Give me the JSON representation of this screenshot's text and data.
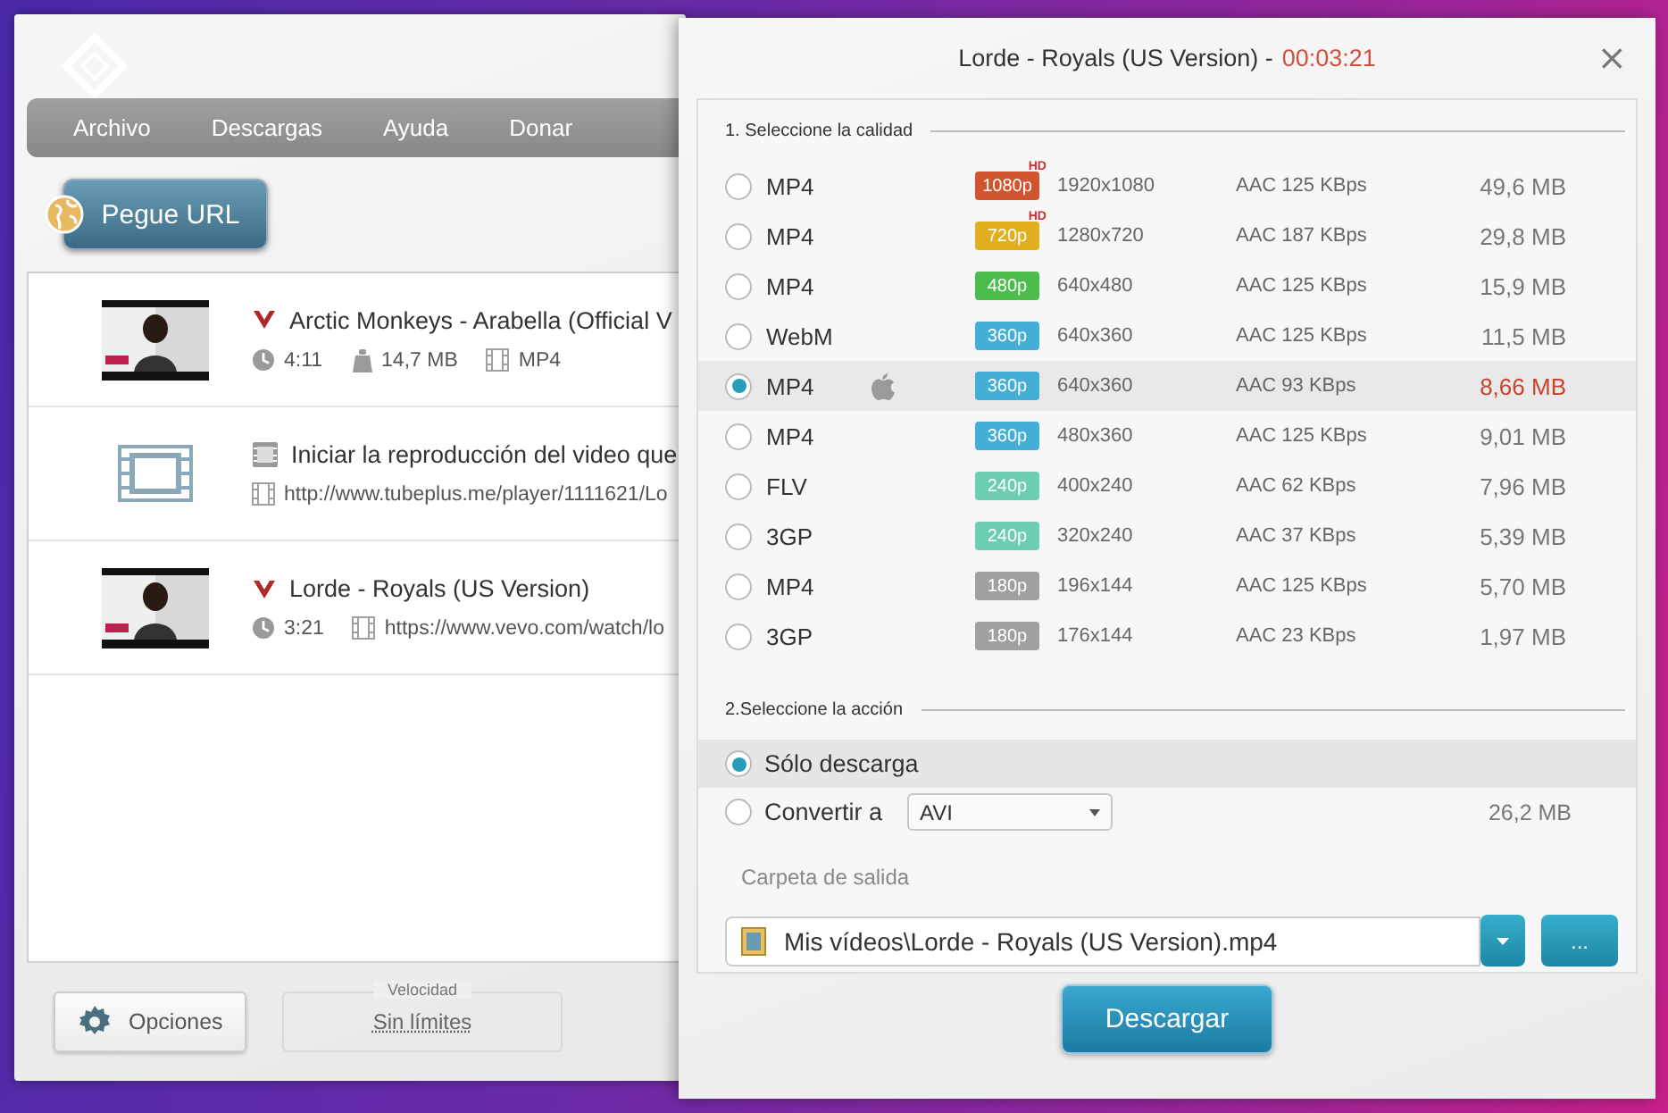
{
  "main_window": {
    "menu": [
      "Archivo",
      "Descargas",
      "Ayuda",
      "Donar"
    ],
    "paste_button": "Pegue URL",
    "downloads": [
      {
        "kind": "video",
        "title": "Arctic Monkeys - Arabella (Official V",
        "meta": [
          {
            "kind": "duration",
            "text": "4:11"
          },
          {
            "kind": "size",
            "text": "14,7 MB"
          },
          {
            "kind": "format",
            "text": "MP4"
          }
        ]
      },
      {
        "kind": "link",
        "title": "Iniciar la reproducción del video que",
        "meta": [
          {
            "kind": "url",
            "text": "http://www.tubeplus.me/player/1111621/Lo"
          }
        ]
      },
      {
        "kind": "video",
        "title": "Lorde - Royals (US Version)",
        "meta": [
          {
            "kind": "duration",
            "text": "3:21"
          },
          {
            "kind": "url",
            "text": "https://www.vevo.com/watch/lo"
          }
        ]
      }
    ],
    "options_button": "Opciones",
    "speed": {
      "label": "Velocidad",
      "value": "Sin límites"
    }
  },
  "dialog": {
    "title": "Lorde - Royals (US Version) -",
    "duration": "00:03:21",
    "close": "×",
    "quality_heading": "1. Seleccione la calidad",
    "qualities": [
      {
        "format": "MP4",
        "preset_icon": false,
        "badge": "1080p",
        "hd_label": "HD",
        "color": "#d0552e",
        "resolution": "1920x1080",
        "audio": "AAC 125  KBps",
        "size": "49,6 MB",
        "selected": false
      },
      {
        "format": "MP4",
        "preset_icon": false,
        "badge": "720p",
        "hd_label": "HD",
        "color": "#e0ae1e",
        "resolution": "1280x720",
        "audio": "AAC 187  KBps",
        "size": "29,8 MB",
        "selected": false
      },
      {
        "format": "MP4",
        "preset_icon": false,
        "badge": "480p",
        "color": "#4cbc4c",
        "resolution": "640x480",
        "audio": "AAC 125  KBps",
        "size": "15,9 MB",
        "selected": false
      },
      {
        "format": "WebM",
        "preset_icon": false,
        "badge": "360p",
        "color": "#45aed6",
        "resolution": "640x360",
        "audio": "AAC 125  KBps",
        "size": "11,5 MB",
        "selected": false
      },
      {
        "format": "MP4",
        "preset_icon": true,
        "badge": "360p",
        "color": "#45aed6",
        "resolution": "640x360",
        "audio": "AAC 93  KBps",
        "size": "8,66 MB",
        "selected": true
      },
      {
        "format": "MP4",
        "preset_icon": false,
        "badge": "360p",
        "color": "#45aed6",
        "resolution": "480x360",
        "audio": "AAC 125  KBps",
        "size": "9,01 MB",
        "selected": false
      },
      {
        "format": "FLV",
        "preset_icon": false,
        "badge": "240p",
        "color": "#6ccdb0",
        "resolution": "400x240",
        "audio": "AAC 62  KBps",
        "size": "7,96 MB",
        "selected": false
      },
      {
        "format": "3GP",
        "preset_icon": false,
        "badge": "240p",
        "color": "#6ccdb0",
        "resolution": "320x240",
        "audio": "AAC 37  KBps",
        "size": "5,39 MB",
        "selected": false
      },
      {
        "format": "MP4",
        "preset_icon": false,
        "badge": "180p",
        "color": "#a0a0a0",
        "resolution": "196x144",
        "audio": "AAC 125  KBps",
        "size": "5,70 MB",
        "selected": false
      },
      {
        "format": "3GP",
        "preset_icon": false,
        "badge": "180p",
        "color": "#a0a0a0",
        "resolution": "176x144",
        "audio": "AAC 23  KBps",
        "size": "1,97 MB",
        "selected": false
      }
    ],
    "action_heading": "2.Seleccione la acción",
    "actions": [
      {
        "kind": "plain",
        "label": "Sólo descarga",
        "selected": true
      },
      {
        "kind": "convert",
        "label": "Convertir a",
        "value": "AVI",
        "size": "26,2 MB",
        "selected": false
      }
    ],
    "folder_label": "Carpeta de salida",
    "folder_path": "Mis vídeos\\Lorde - Royals (US Version).mp4",
    "browse_button": "...",
    "download_button": "Descargar"
  }
}
